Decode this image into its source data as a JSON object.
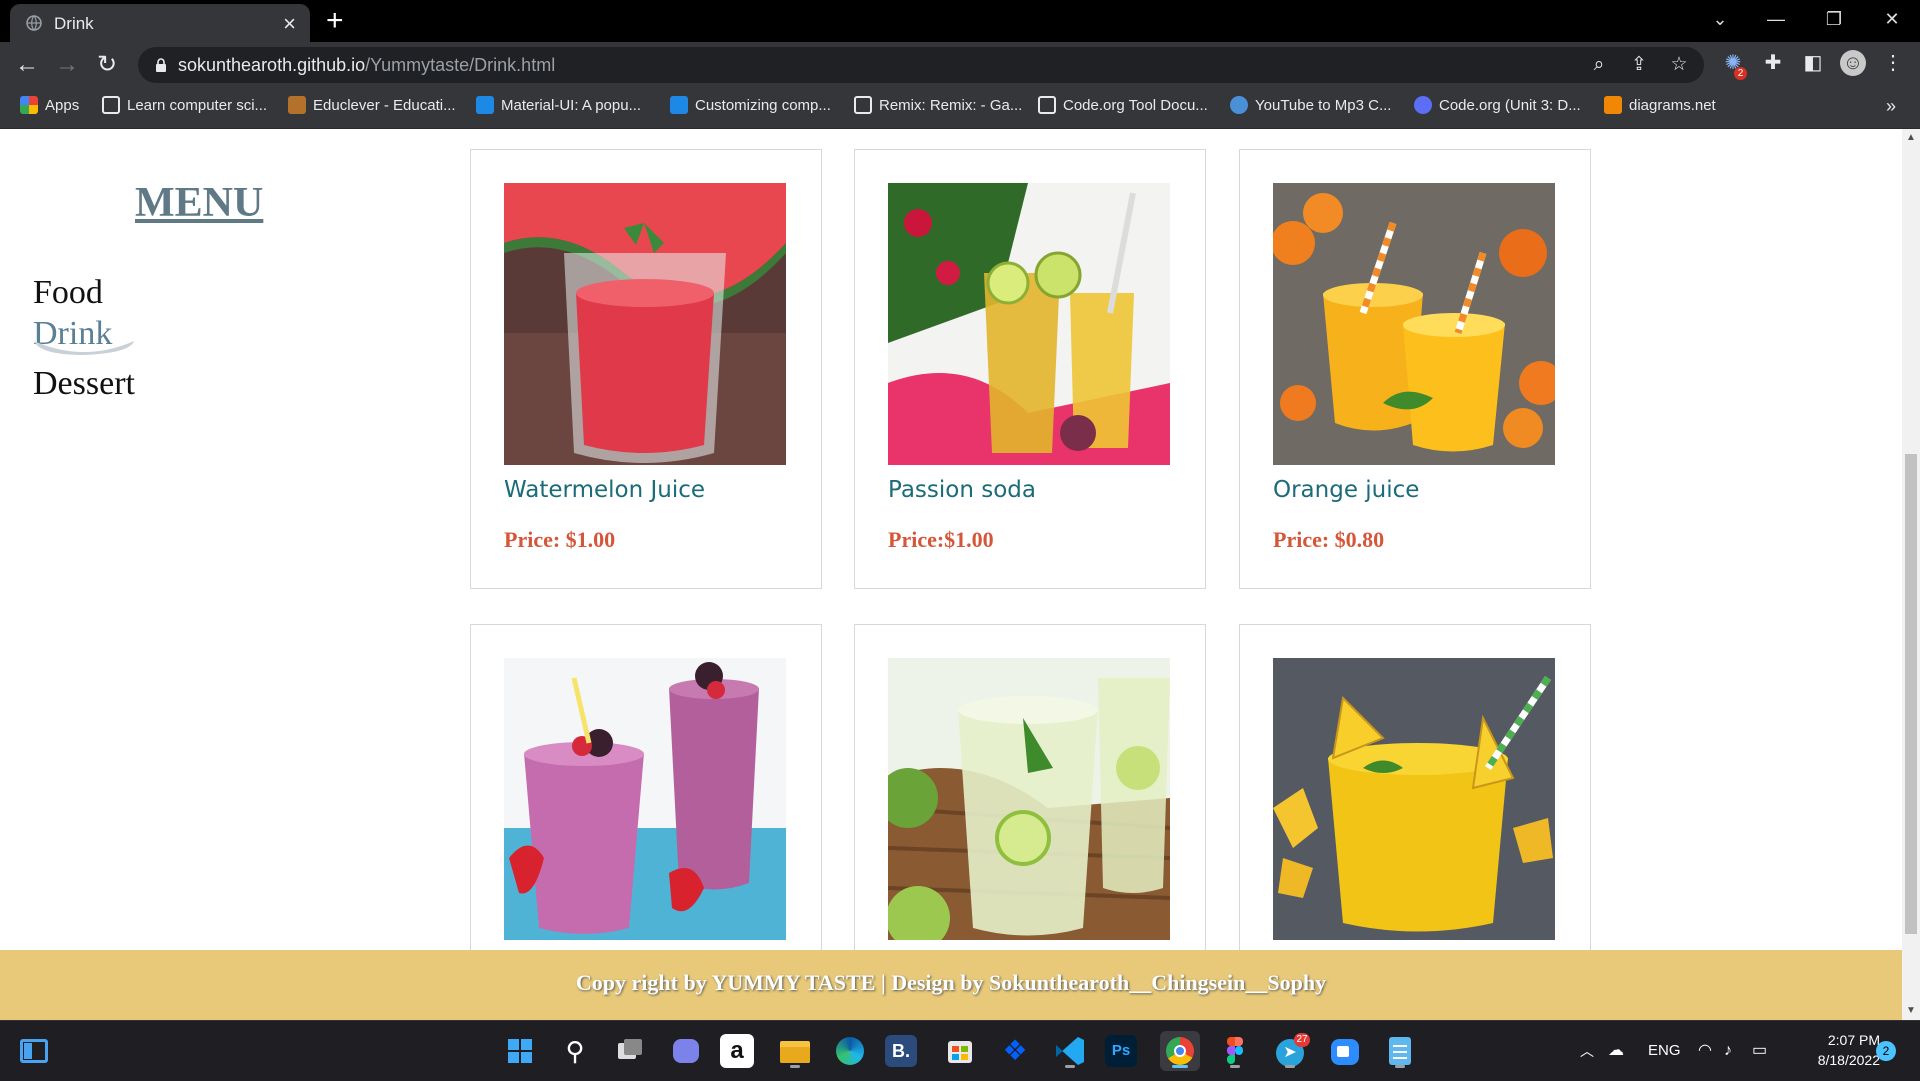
{
  "browser": {
    "tab_title": "Drink",
    "url_host": "sokunthearoth.github.io",
    "url_path": "/Yummytaste/Drink.html",
    "extension_badge": "2",
    "bookmarks": [
      {
        "label": "Apps",
        "color": "#4285f4"
      },
      {
        "label": "Learn computer sci...",
        "color": "#e8eaed"
      },
      {
        "label": "Educlever - Educati...",
        "color": "#b3712b"
      },
      {
        "label": "Material-UI: A popu...",
        "color": "#1e88e5"
      },
      {
        "label": "Customizing comp...",
        "color": "#1e88e5"
      },
      {
        "label": "Remix: Remix: - Ga...",
        "color": "#e8eaed"
      },
      {
        "label": "Code.org Tool Docu...",
        "color": "#e8eaed"
      },
      {
        "label": "YouTube to Mp3 C...",
        "color": "#4a90d9"
      },
      {
        "label": "Code.org (Unit 3: D...",
        "color": "#5b6ef5"
      },
      {
        "label": "diagrams.net",
        "color": "#f08705"
      }
    ]
  },
  "sidebar": {
    "title": "MENU",
    "links": [
      "Food",
      "Drink",
      "Dessert"
    ],
    "active": "Drink"
  },
  "products": [
    {
      "name": "Watermelon Juice",
      "price": "Price: $1.00"
    },
    {
      "name": "Passion soda",
      "price": "Price:$1.00"
    },
    {
      "name": "Orange juice",
      "price": "Price: $0.80"
    },
    {
      "name": "",
      "price": ""
    },
    {
      "name": "",
      "price": ""
    },
    {
      "name": "",
      "price": ""
    }
  ],
  "footer": {
    "text": "Copy right by YUMMY TASTE | Design by Sokunthearoth__Chingsein__Sophy"
  },
  "taskbar": {
    "language": "ENG",
    "time": "2:07 PM",
    "date": "8/18/2022",
    "notifications": "2",
    "telegram_badge": "27"
  },
  "colors": {
    "menu_title": "#607986",
    "active_link": "#5b7f95",
    "product_name": "#1b6b78",
    "price": "#d6563a",
    "footer_bg": "#e8c979"
  }
}
